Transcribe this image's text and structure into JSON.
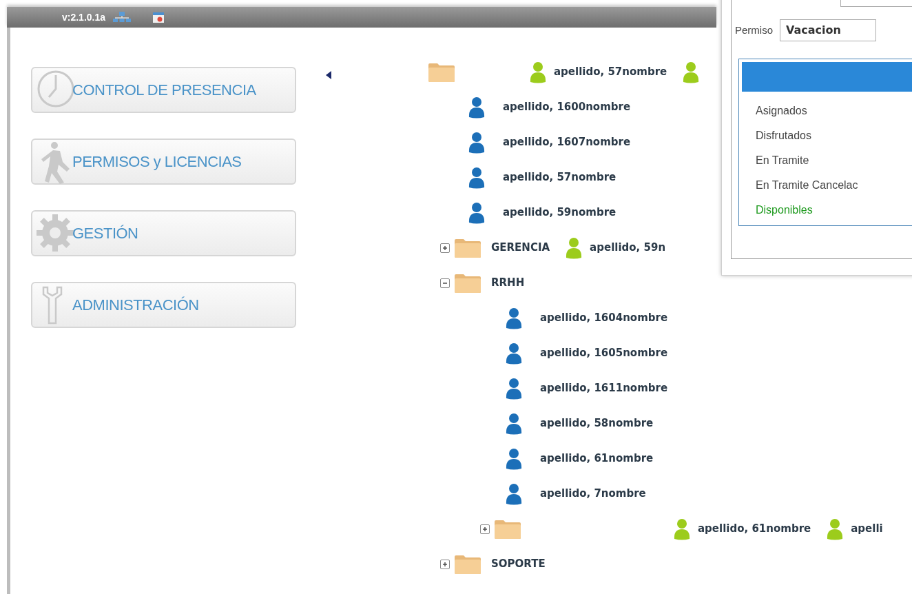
{
  "top_bar": {
    "version": "v:2.1.0.1a"
  },
  "menu": [
    {
      "kind": "clock",
      "label": "CONTROL DE PRESENCIA"
    },
    {
      "kind": "walker",
      "label": "PERMISOS y LICENCIAS"
    },
    {
      "kind": "gear",
      "label": "GESTIÓN"
    },
    {
      "kind": "wrench",
      "label": "ADMINISTRACIÓN"
    }
  ],
  "tree": [
    {
      "kind": "folder",
      "managers": [
        {
          "kind": "person",
          "name": "apellido, 57nombre"
        },
        {
          "kind": "person"
        }
      ],
      "children": [
        {
          "kind": "person",
          "name": "apellido, 1600nombre"
        },
        {
          "kind": "person",
          "name": "apellido, 1607nombre"
        },
        {
          "kind": "person",
          "name": "apellido, 57nombre"
        },
        {
          "kind": "person",
          "name": "apellido, 59nombre"
        }
      ]
    },
    {
      "kind": "folder",
      "name": "GERENCIA",
      "expanded": false,
      "managers": [
        {
          "kind": "person",
          "name": "apellido, 59n"
        }
      ]
    },
    {
      "kind": "folder",
      "name": "RRHH",
      "expanded": true,
      "children": [
        {
          "kind": "person",
          "name": "apellido, 1604nombre"
        },
        {
          "kind": "person",
          "name": "apellido, 1605nombre"
        },
        {
          "kind": "person",
          "name": "apellido, 1611nombre"
        },
        {
          "kind": "person",
          "name": "apellido, 58nombre"
        },
        {
          "kind": "person",
          "name": "apellido, 61nombre"
        },
        {
          "kind": "person",
          "name": "apellido, 7nombre"
        },
        {
          "kind": "folder",
          "expanded": false,
          "managers": [
            {
              "kind": "person",
              "name": "apellido, 61nombre"
            },
            {
              "kind": "person",
              "name": "apelli"
            }
          ]
        }
      ]
    },
    {
      "kind": "folder",
      "name": "SOPORTE",
      "expanded": false
    }
  ],
  "panel": {
    "permiso_label": "Permiso",
    "permiso_value": "Vacacion",
    "rows": [
      {
        "label": "Asignados",
        "highlight": false
      },
      {
        "label": "Disfrutados",
        "highlight": false
      },
      {
        "label": "En Tramite",
        "highlight": false
      },
      {
        "label": "En Tramite Cancelac",
        "highlight": false
      },
      {
        "label": "Disponibles",
        "highlight": true
      }
    ]
  }
}
